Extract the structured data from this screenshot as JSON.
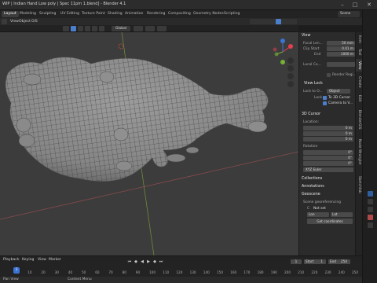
{
  "titlebar": {
    "title": "WIP | Indian Hand Low poly | Spec 11pm 1.blend] - Blender 4.1",
    "min": "–",
    "max": "□",
    "close": "✕"
  },
  "workspaces": {
    "tabs": [
      "Layout",
      "Modeling",
      "Sculpting",
      "UV Editing",
      "Texture Paint",
      "Shading",
      "Animation",
      "Rendering",
      "Compositing",
      "Geometry Nodes",
      "Scripting"
    ],
    "scene_label": "Scene"
  },
  "menubar": {
    "items": [
      "View",
      "Object",
      "GIS"
    ]
  },
  "toolbar": {
    "transform": "Global"
  },
  "npanel": {
    "view": {
      "title": "View",
      "focal_label": "Focal Len...",
      "focal_value": "50 mm",
      "clip_start_label": "Clip Start",
      "clip_start_value": "0.01 m",
      "clip_end_label": "End",
      "clip_end_value": "1000 m",
      "local_camera_label": "Local Ca...",
      "render_region": "Render Regi..."
    },
    "view_lock": {
      "title": "View Lock",
      "lock_to_label": "Lock to O...",
      "lock_to_value": "Object",
      "lock_label": "Lock",
      "to3d": "To 3D Cursor",
      "camera": "Camera to V..."
    },
    "cursor": {
      "title": "3D Cursor",
      "location": "Location:",
      "rotation": "Rotation",
      "x": "X",
      "y": "Y",
      "z": "Z",
      "loc_x": "0 m",
      "loc_y": "0 m",
      "loc_z": "0 m",
      "rot_x": "0°",
      "rot_y": "0°",
      "rot_z": "0°",
      "mode": "XYZ Euler"
    },
    "collections": "Collections",
    "annotations": "Annotations",
    "geoscene": {
      "title": "Geoscene",
      "georef_label": "Scene georeferencing",
      "crs_label": "C",
      "crs_value": "Not set",
      "lon": "Lon",
      "lat": "Lat",
      "lon_value": "0.0",
      "lat_value": "0.0",
      "get_coords": "Get coordinates"
    }
  },
  "vtabs": [
    "Item",
    "Tool",
    "View",
    "Create",
    "Edit",
    "BlenderGIS",
    "Node Wrangler",
    "Sketchfab"
  ],
  "timeline": {
    "playback": "Playback",
    "keying": "Keying",
    "view": "View",
    "marker": "Marker",
    "current_frame": "1",
    "start_label": "Start",
    "start_value": "1",
    "end_label": "End",
    "end_value": "250",
    "frames": [
      "0",
      "10",
      "20",
      "30",
      "40",
      "50",
      "60",
      "70",
      "80",
      "90",
      "100",
      "110",
      "120",
      "130",
      "140",
      "150",
      "160",
      "170",
      "180",
      "190",
      "200",
      "210",
      "220",
      "230",
      "240",
      "250"
    ]
  },
  "status": {
    "left": "Pan View",
    "right": "Context Menu"
  },
  "colors": {
    "accent": "#4c7fcb",
    "viewport_bg": "#3c3c3c",
    "mesh": "#8a8a8a",
    "wire": "#2f2f2f",
    "gizmo_x": "#e53f4f",
    "gizmo_y": "#74b236",
    "gizmo_z": "#3c74d6"
  }
}
